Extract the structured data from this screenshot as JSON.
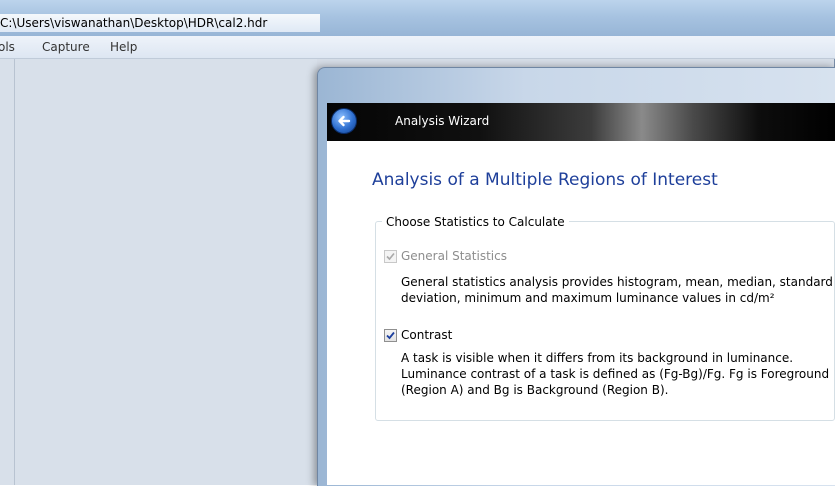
{
  "window": {
    "title": "C:\\Users\\viswanathan\\Desktop\\HDR\\cal2.hdr"
  },
  "menu": {
    "items": [
      "ols",
      "Capture",
      "Help"
    ]
  },
  "wizard": {
    "header_title": "Analysis Wizard",
    "heading": "Analysis of a Multiple Regions of Interest",
    "group_label": "Choose Statistics to Calculate",
    "general": {
      "label": "General Statistics",
      "checked": true,
      "enabled": false,
      "description_line1": "General statistics analysis provides histogram, mean, median, standard",
      "description_line2": "deviation, minimum and maximum luminance values in cd/m²"
    },
    "contrast": {
      "label": "Contrast",
      "checked": true,
      "enabled": true,
      "description_line1": "A task is visible when it differs from its background in luminance.",
      "description_line2": "Luminance contrast of a task is defined as (Fg-Bg)/Fg. Fg is Foreground",
      "description_line3": "(Region A) and Bg is Background (Region B)."
    }
  },
  "colors": {
    "heading": "#1e3f9a",
    "back_button": "#2e6fd0",
    "app_background": "#d6dde7"
  },
  "icons": {
    "back": "back-arrow-icon",
    "check": "checkmark-icon"
  }
}
